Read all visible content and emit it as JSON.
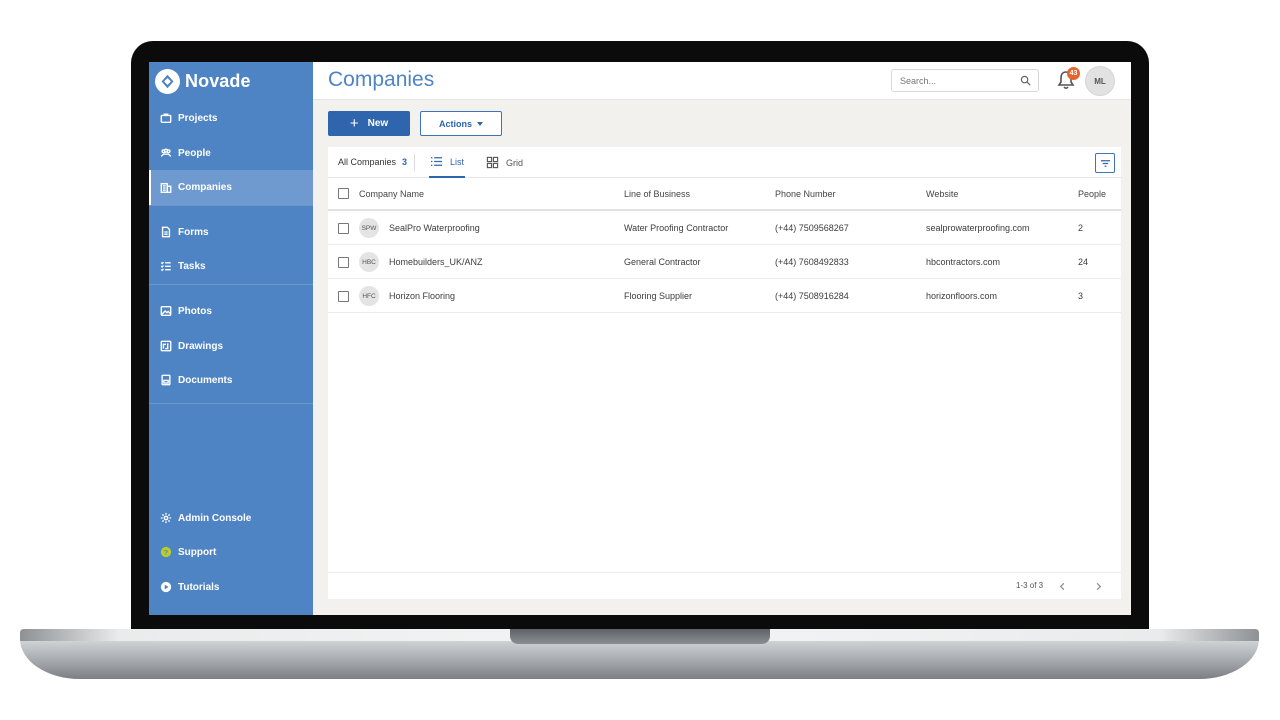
{
  "app": {
    "brand": "Novade",
    "page_title": "Companies"
  },
  "sidebar": {
    "items": [
      {
        "label": "Projects",
        "icon": "briefcase-icon"
      },
      {
        "label": "People",
        "icon": "people-icon"
      },
      {
        "label": "Companies",
        "icon": "building-icon",
        "active": true
      },
      {
        "label": "Forms",
        "icon": "form-icon"
      },
      {
        "label": "Tasks",
        "icon": "checklist-icon"
      },
      {
        "label": "Photos",
        "icon": "photo-icon"
      },
      {
        "label": "Drawings",
        "icon": "drawing-icon"
      },
      {
        "label": "Documents",
        "icon": "document-icon"
      }
    ],
    "bottom_items": [
      {
        "label": "Admin Console",
        "icon": "gear-icon"
      },
      {
        "label": "Support",
        "icon": "help-icon"
      },
      {
        "label": "Tutorials",
        "icon": "play-icon"
      }
    ]
  },
  "header": {
    "search_placeholder": "Search...",
    "notification_count": "43",
    "user_initials": "ML"
  },
  "toolbar": {
    "new_label": "New",
    "actions_label": "Actions"
  },
  "tabs": {
    "all_label": "All Companies",
    "all_count": "3",
    "list_label": "List",
    "grid_label": "Grid"
  },
  "table": {
    "columns": [
      "Company Name",
      "Line of Business",
      "Phone Number",
      "Website",
      "People"
    ],
    "rows": [
      {
        "initials": "SPW",
        "name": "SealPro Waterproofing",
        "business": "Water Proofing Contractor",
        "phone": "(+44) 7509568267",
        "website": "sealprowaterproofing.com",
        "people": "2"
      },
      {
        "initials": "HBC",
        "name": "Homebuilders_UK/ANZ",
        "business": "General Contractor",
        "phone": "(+44) 7608492833",
        "website": "hbcontractors.com",
        "people": "24"
      },
      {
        "initials": "HFC",
        "name": "Horizon Flooring",
        "business": "Flooring Supplier",
        "phone": "(+44) 7508916284",
        "website": "horizonfloors.com",
        "people": "3"
      }
    ]
  },
  "pagination": {
    "text": "1-3 of 3"
  },
  "colors": {
    "sidebar": "#4f84c4",
    "primary": "#2f65ad",
    "badge": "#e7652c"
  }
}
